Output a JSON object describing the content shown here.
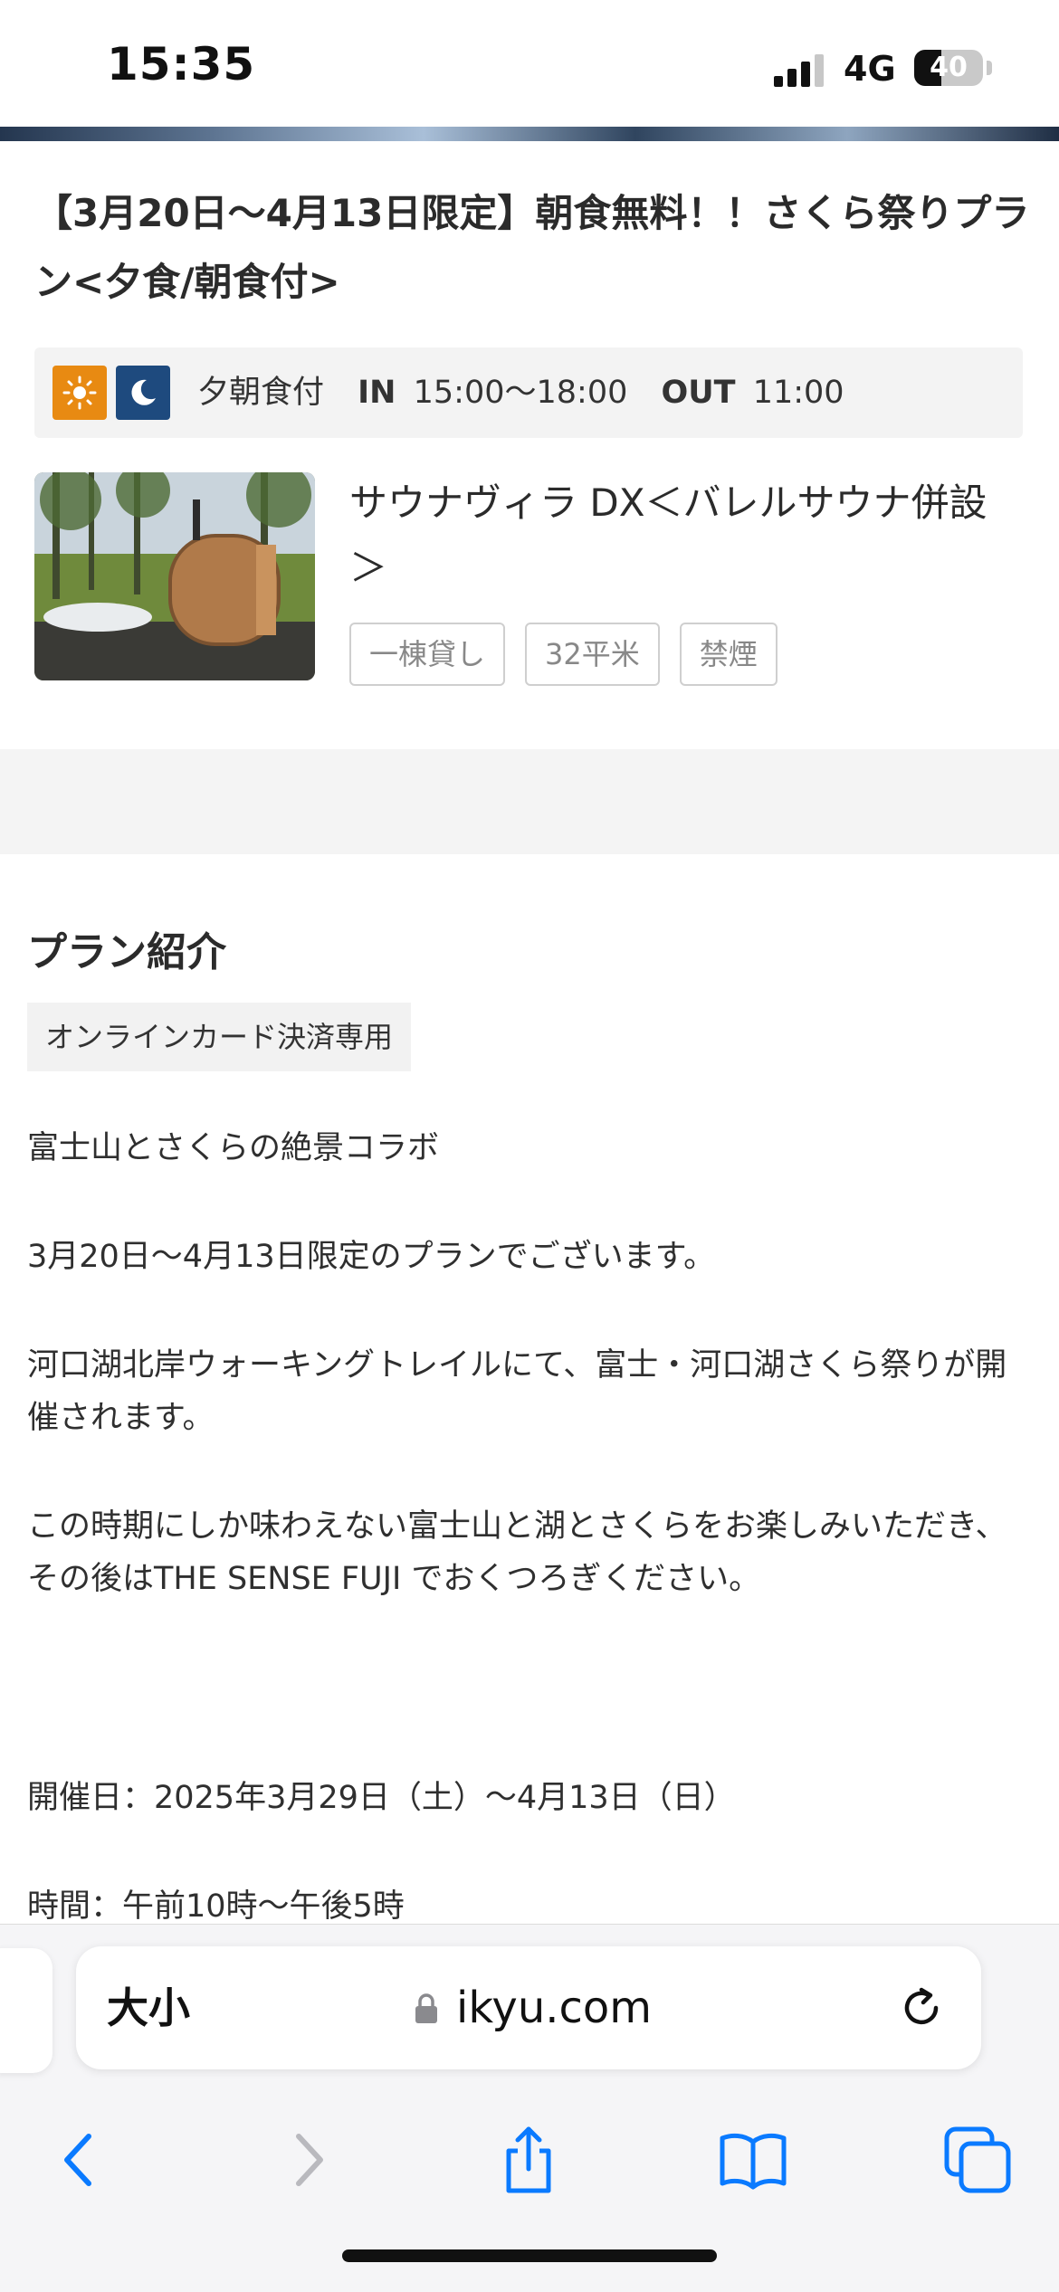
{
  "status_bar": {
    "time": "15:35",
    "network": "4G",
    "battery": "40",
    "battery_level": 0.4
  },
  "plan": {
    "title": "【3月20日〜4月13日限定】朝食無料！！さくら祭りプラン<夕食/朝食付>",
    "meal_label": "夕朝食付",
    "checkin_label": "IN",
    "checkin_value": "15:00〜18:00",
    "checkout_label": "OUT",
    "checkout_value": "11:00"
  },
  "room": {
    "name": "サウナヴィラ DX＜バレルサウナ併設＞",
    "tags": [
      "一棟貸し",
      "32平米",
      "禁煙"
    ]
  },
  "intro": {
    "heading": "プラン紹介",
    "payment_badge": "オンラインカード決済専用",
    "paragraphs": [
      "富士山とさくらの絶景コラボ",
      "3月20日〜4月13日限定のプランでございます。",
      "河口湖北岸ウォーキングトレイルにて、富士・河口湖さくら祭りが開催されます。",
      "この時期にしか味わえない富士山と湖とさくらをお楽しみいただき、その後はTHE SENSE FUJI でおくつろぎください。",
      "開催日：2025年3月29日（土）〜4月13日（日）",
      "時間：午前10時〜午後5時"
    ]
  },
  "browser": {
    "text_size_label": "大小",
    "url": "ikyu.com"
  },
  "icons": {
    "sun": "sun-icon",
    "moon": "moon-icon",
    "lock": "lock-icon",
    "reload": "reload-icon",
    "back": "chevron-left-icon",
    "forward": "chevron-right-icon",
    "share": "share-icon",
    "bookmarks": "book-icon",
    "tabs": "tabs-icon"
  },
  "colors": {
    "accent": "#0a7aff",
    "sun_badge": "#e88a12",
    "moon_badge": "#1e4a7e"
  }
}
